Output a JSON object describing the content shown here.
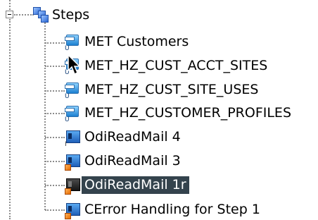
{
  "tree": {
    "root": {
      "label": "Steps",
      "icon": "steps-folder-icon",
      "expanded": true
    },
    "children": [
      {
        "label": "MET Customers",
        "icon": "interface-icon",
        "selected": false
      },
      {
        "label": "MET_HZ_CUST_ACCT_SITES",
        "icon": "interface-icon",
        "selected": false
      },
      {
        "label": "MET_HZ_CUST_SITE_USES",
        "icon": "interface-icon",
        "selected": false
      },
      {
        "label": "MET_HZ_CUSTOMER_PROFILES",
        "icon": "interface-icon",
        "selected": false
      },
      {
        "label": "OdiReadMail 4",
        "icon": "procedure-icon",
        "selected": false
      },
      {
        "label": "OdiReadMail 3",
        "icon": "procedure-icon",
        "selected": false
      },
      {
        "label": "OdiReadMail 1r",
        "icon": "procedure-icon",
        "selected": true
      },
      {
        "label": "CError Handling for Step 1",
        "icon": "procedure-icon",
        "selected": false
      }
    ]
  },
  "colors": {
    "selection_background": "#34434d",
    "selection_text": "#ffffff",
    "connector": "#8c8c8c"
  }
}
